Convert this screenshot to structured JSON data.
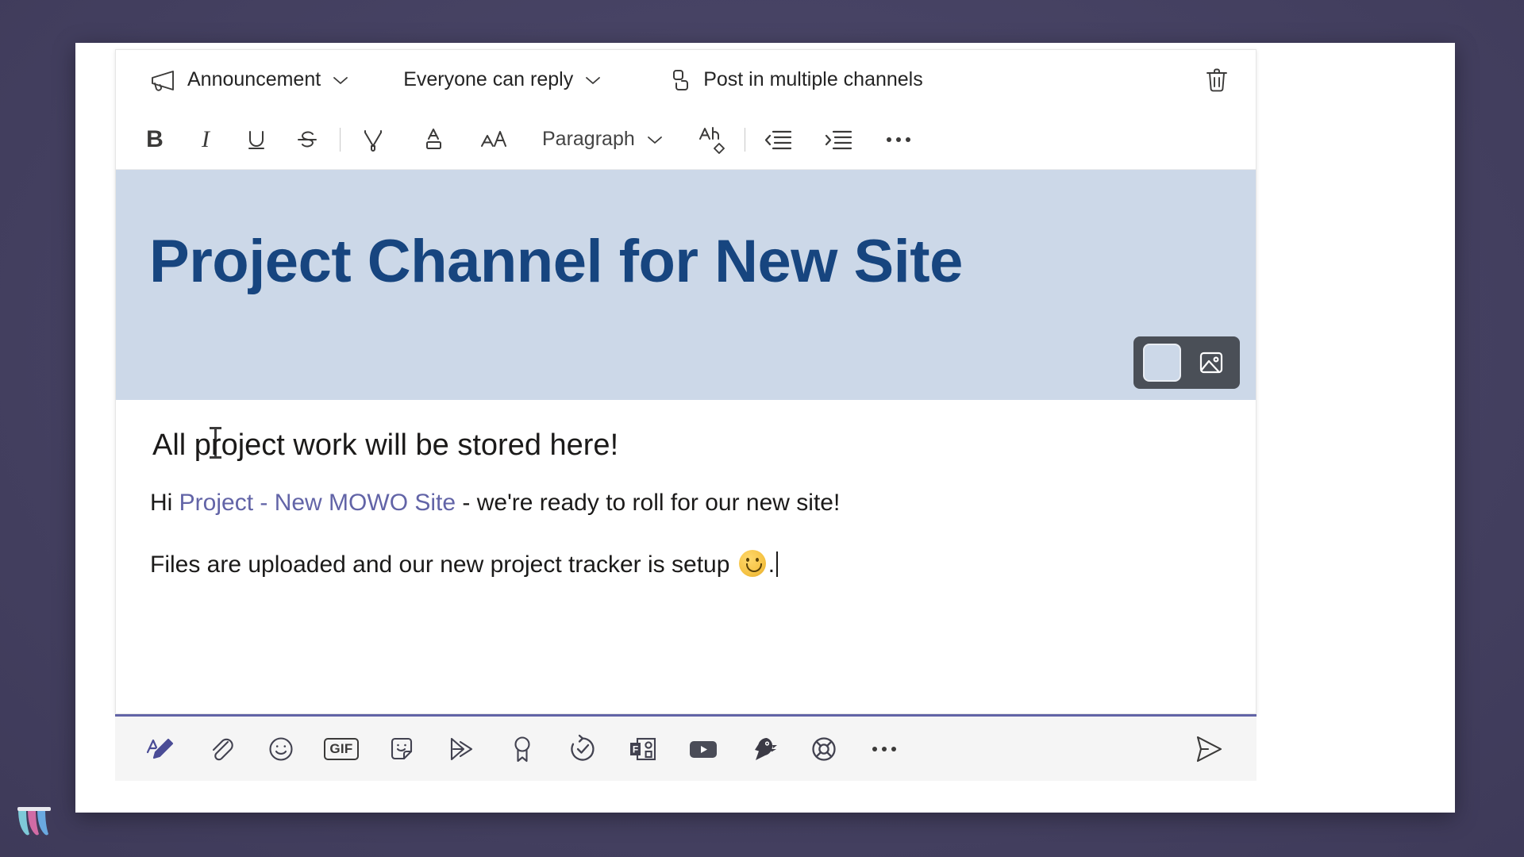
{
  "window": {
    "taskbar_logo_name": "wordpress-logo"
  },
  "compose": {
    "options": [
      {
        "label": "Announcement",
        "icon": "megaphone-icon",
        "has_caret": true,
        "name": "post-type-selector"
      },
      {
        "label": "Everyone can reply",
        "icon": null,
        "has_caret": true,
        "name": "reply-permission-selector"
      },
      {
        "label": "Post in multiple channels",
        "icon": "multi-channel-icon",
        "has_caret": false,
        "name": "post-multiple-channels-button"
      }
    ],
    "delete_draft": {
      "label": "Delete draft",
      "icon": "trash-icon"
    },
    "format_toolbar": [
      {
        "name": "bold-button",
        "icon": "bold-icon",
        "label": "B"
      },
      {
        "name": "italic-button",
        "icon": "italic-icon",
        "label": "I"
      },
      {
        "name": "underline-button",
        "icon": "underline-icon",
        "label": "U"
      },
      {
        "name": "strikethrough-button",
        "icon": "strikethrough-icon",
        "label": "S"
      },
      {
        "name": "highlight-button",
        "icon": "highlighter-icon",
        "label": ""
      },
      {
        "name": "font-color-button",
        "icon": "font-color-icon",
        "label": ""
      },
      {
        "name": "font-size-button",
        "icon": "font-size-icon",
        "label": ""
      },
      {
        "name": "paragraph-style-selector",
        "icon": "chevron-down-icon",
        "label": "Paragraph"
      },
      {
        "name": "clear-formatting-button",
        "icon": "clear-formatting-icon",
        "label": ""
      },
      {
        "name": "decrease-indent-button",
        "icon": "decrease-indent-icon",
        "label": ""
      },
      {
        "name": "increase-indent-button",
        "icon": "increase-indent-icon",
        "label": ""
      },
      {
        "name": "more-formatting-options-button",
        "icon": "ellipsis-icon",
        "label": ""
      }
    ],
    "banner": {
      "headline": "Project Channel for New Site",
      "background_color": "#ccd8e8",
      "headline_color": "#17457f",
      "color_swatch_label": "Background color",
      "image_button_label": "Change image",
      "image_icon": "image-icon"
    },
    "message": {
      "heading": "All project work will be stored here!",
      "line2_prefix": "Hi ",
      "line2_mention": "Project - New MOWO Site",
      "line2_suffix": " - we're ready to roll for our new site!",
      "line3_prefix": "Files are uploaded and our new project tracker is setup ",
      "line3_emoji": "slightly-smiling-face",
      "line3_suffix": "."
    },
    "action_bar": [
      {
        "name": "format-button",
        "icon": "format-text-icon",
        "active": true
      },
      {
        "name": "attach-file-button",
        "icon": "paperclip-icon",
        "active": false
      },
      {
        "name": "emoji-button",
        "icon": "smiley-icon",
        "active": false
      },
      {
        "name": "giphy-button",
        "icon": "gif-icon",
        "label": "GIF",
        "active": false
      },
      {
        "name": "sticker-button",
        "icon": "sticker-icon",
        "active": false
      },
      {
        "name": "stream-button",
        "icon": "stream-icon",
        "active": false
      },
      {
        "name": "praise-button",
        "icon": "award-ribbon-icon",
        "active": false
      },
      {
        "name": "approvals-button",
        "icon": "approvals-icon",
        "active": false
      },
      {
        "name": "forms-button",
        "icon": "forms-icon",
        "active": false
      },
      {
        "name": "youtube-button",
        "icon": "youtube-icon",
        "active": false
      },
      {
        "name": "polly-button",
        "icon": "parrot-icon",
        "active": false
      },
      {
        "name": "support-button",
        "icon": "lifebuoy-icon",
        "active": false
      },
      {
        "name": "more-apps-button",
        "icon": "ellipsis-icon",
        "active": false
      }
    ],
    "send": {
      "label": "Send",
      "icon": "send-icon"
    }
  },
  "colors": {
    "accent": "#6264a7",
    "banner_bg": "#ccd8e8",
    "headline": "#17457f",
    "mention": "#6264a7",
    "desktop": "#4a4668"
  }
}
